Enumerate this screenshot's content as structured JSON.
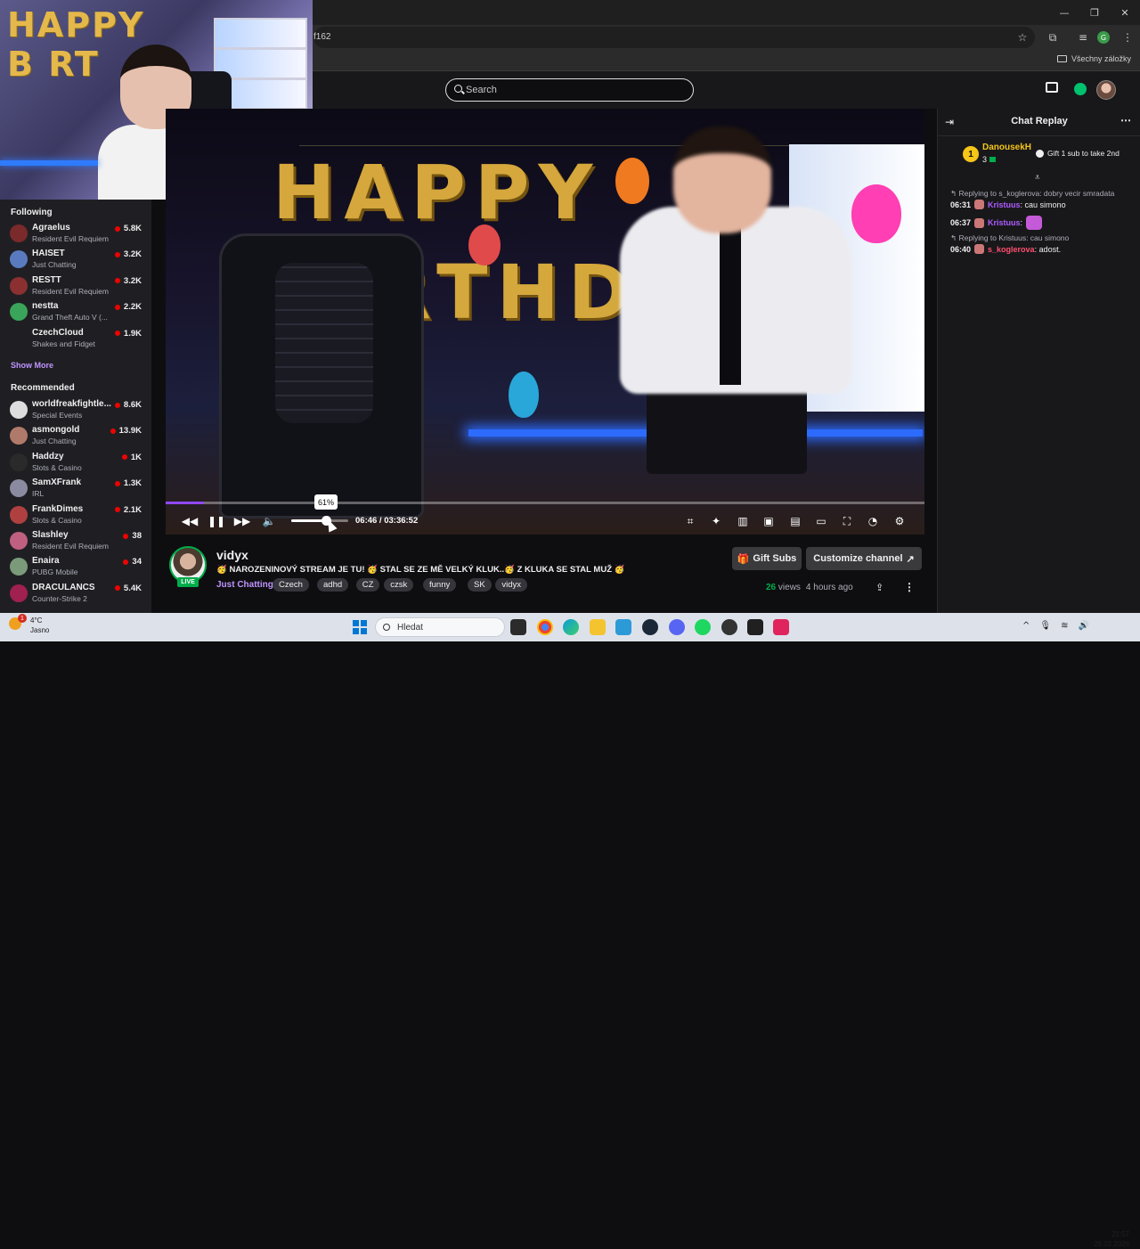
{
  "browser": {
    "url_fragment": "f162",
    "window_controls": [
      "—",
      "❐",
      "✕"
    ],
    "bookmarks_all": "Všechny záložky"
  },
  "topnav": {
    "search_placeholder": "Search"
  },
  "webcam": {
    "balloon_letters": "HAPPY\nB RT"
  },
  "sidebar": {
    "following_header": "Following",
    "following": [
      {
        "name": "Agraelus",
        "game": "Resident Evil Requiem",
        "viewers": "5.8K",
        "avatar_color": "#7a2a2a"
      },
      {
        "name": "HAISET",
        "game": "Just Chatting",
        "viewers": "3.2K",
        "avatar_color": "#5a7ac0"
      },
      {
        "name": "RESTT",
        "game": "Resident Evil Requiem",
        "viewers": "3.2K",
        "avatar_color": "#8a3030"
      },
      {
        "name": "nestta",
        "game": "Grand Theft Auto V (...",
        "viewers": "2.2K",
        "avatar_color": "#3aa55a"
      },
      {
        "name": "CzechCloud",
        "game": "Shakes and Fidget",
        "viewers": "1.9K",
        "avatar_color": "#1f1f23"
      }
    ],
    "show_more": "Show More",
    "recommended_header": "Recommended",
    "recommended": [
      {
        "name": "worldfreakfightle...",
        "game": "Special Events",
        "viewers": "8.6K",
        "avatar_color": "#dddddd"
      },
      {
        "name": "asmongold",
        "game": "Just Chatting",
        "viewers": "13.9K",
        "avatar_color": "#b07a6a"
      },
      {
        "name": "Haddzy",
        "game": "Slots & Casino",
        "viewers": "1K",
        "avatar_color": "#2a2a2a"
      },
      {
        "name": "SamXFrank",
        "game": "IRL",
        "viewers": "1.3K",
        "avatar_color": "#8a8aa0"
      },
      {
        "name": "FrankDimes",
        "game": "Slots & Casino",
        "viewers": "2.1K",
        "avatar_color": "#b04040"
      },
      {
        "name": "Slashley",
        "game": "Resident Evil Requiem",
        "viewers": "38",
        "avatar_color": "#c06080"
      },
      {
        "name": "Enaira",
        "game": "PUBG Mobile",
        "viewers": "34",
        "avatar_color": "#7a9a7a"
      },
      {
        "name": "DRACULANCS",
        "game": "Counter-Strike 2",
        "viewers": "5.4K",
        "avatar_color": "#a02050"
      }
    ]
  },
  "player": {
    "progress": 0.0508,
    "volume_percent": 61,
    "volume_tooltip": "61%",
    "time": "06:46 / 03:36:52"
  },
  "channel": {
    "name": "vidyx",
    "live_badge": "LIVE",
    "title": "🥳 NAROZENINOVÝ STREAM JE TU! 🥳 STAL SE ZE MĚ VELKÝ KLUK..🥳 Z KLUKA SE STAL MUŽ 🥳",
    "category": "Just Chatting",
    "tags": [
      "Czech",
      "adhd",
      "CZ",
      "czsk",
      "funny",
      "SK",
      "vidyx"
    ],
    "gift_subs_label": "Gift Subs",
    "customize_label": "Customize channel",
    "views_count": "26",
    "views_label": "views",
    "age": "4 hours ago"
  },
  "chat": {
    "title": "Chat Replay",
    "gifter": {
      "rank": "1",
      "name": "DanousekH",
      "count": "3"
    },
    "gift_cta": "Gift 1 sub to take 2nd",
    "messages": [
      {
        "reply": "↰ Replying to s_koglerova: dobry vecir smradata",
        "time": "06:31",
        "user": "Kristuus",
        "user_color": "#b05cff",
        "text": ": cau simono"
      },
      {
        "reply": "",
        "time": "06:37",
        "user": "Kristuus",
        "user_color": "#b05cff",
        "text": ":"
      },
      {
        "reply": "↰ Replying to Kristuus: cau simono",
        "time": "06:40",
        "user": "s_koglerova",
        "user_color": "#ff4f6e",
        "text": ": adost."
      }
    ]
  },
  "taskbar": {
    "weather_temp": "4°C",
    "weather_text": "Jasno",
    "notification_count": "1",
    "search_placeholder": "Hledat",
    "time": "21:57",
    "date": "28.02.2026"
  },
  "colors": {
    "twitch_purple": "#9147ff",
    "live_green": "#00ad4b",
    "live_red": "#eb0400"
  }
}
